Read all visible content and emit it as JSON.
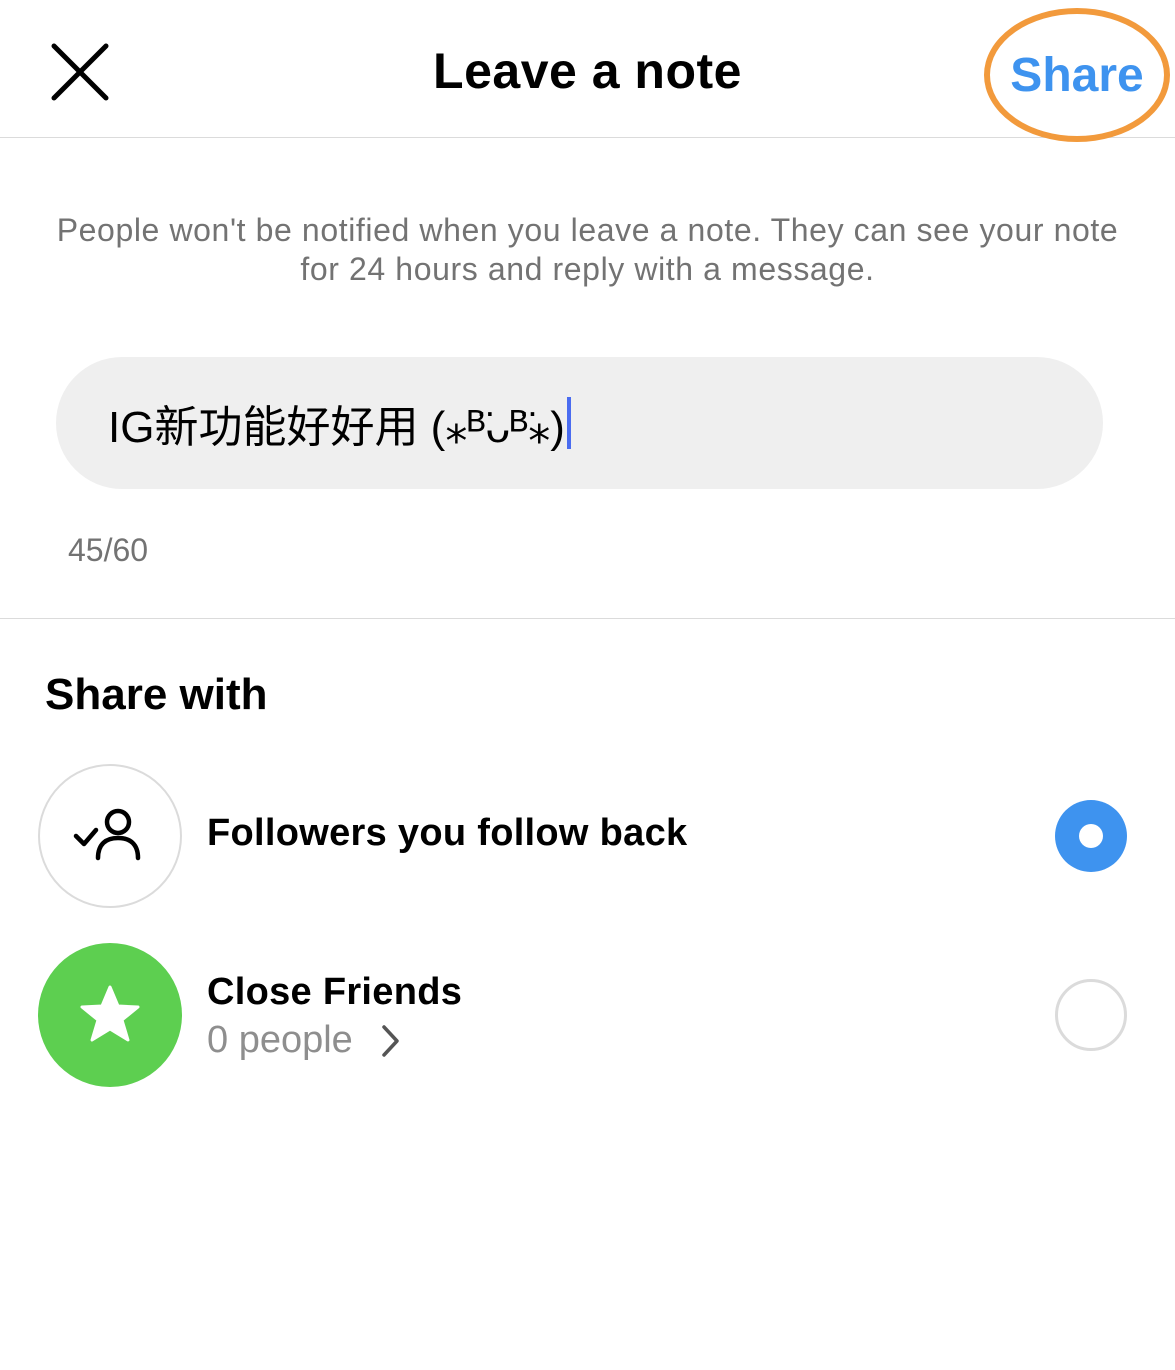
{
  "header": {
    "title": "Leave a note",
    "share_label": "Share",
    "close_icon": "close-x-icon"
  },
  "info_text": "People won't be notified when you leave a note. They can see your note for 24 hours and reply with a message.",
  "note": {
    "value": "IG新功能好好用 (⁎ᴮ̈ᴗᴮ̈⁎)",
    "counter": "45/60"
  },
  "share_with": {
    "title": "Share with",
    "options": [
      {
        "label": "Followers you follow back",
        "icon": "followers-follow-back-icon",
        "selected": true
      },
      {
        "label": "Close Friends",
        "sub": "0 people",
        "icon": "star-icon",
        "selected": false
      }
    ]
  },
  "colors": {
    "accent_blue": "#3e93ef",
    "highlight_orange": "#f29a3c",
    "close_friends_green": "#5dcf50",
    "secondary_text": "#737373"
  }
}
